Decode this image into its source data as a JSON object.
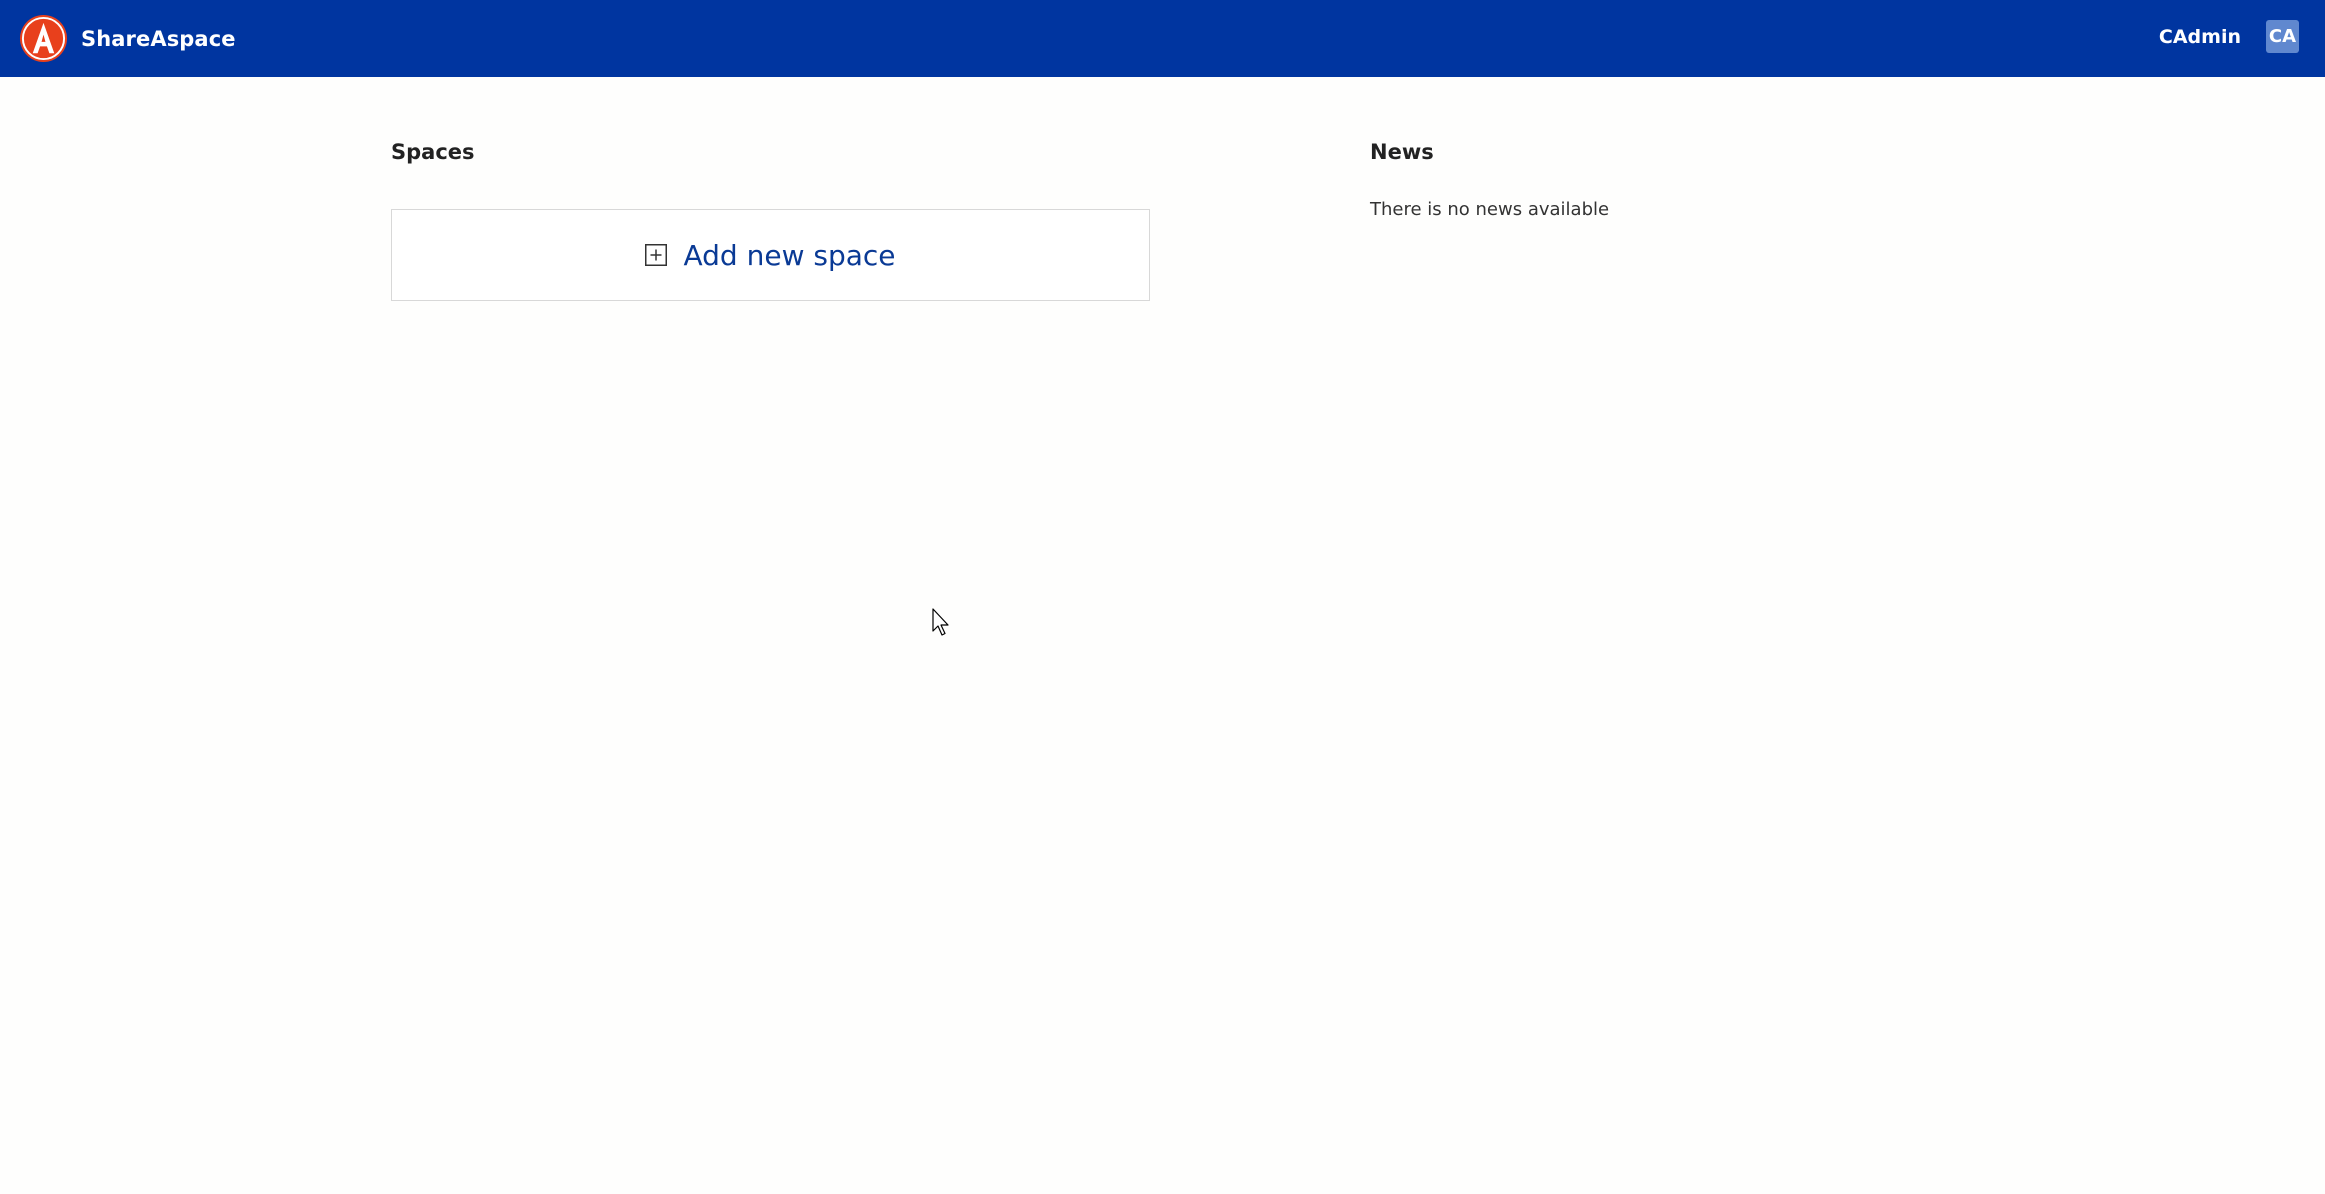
{
  "header": {
    "brand_name": "ShareAspace",
    "user_name": "CAdmin",
    "avatar_initials": "CA",
    "bar_color": "#0035a0",
    "logo_color": "#e8401c"
  },
  "spaces": {
    "title": "Spaces",
    "add_label": "Add new space",
    "add_icon": "plus-square-icon"
  },
  "news": {
    "title": "News",
    "empty_text": "There is no news available"
  }
}
